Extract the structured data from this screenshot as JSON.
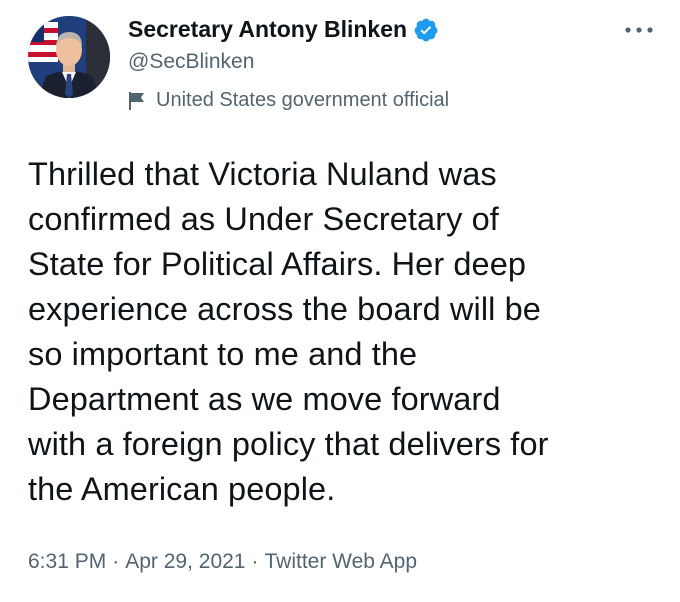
{
  "author": {
    "display_name": "Secretary Antony Blinken",
    "handle": "@SecBlinken",
    "label": "United States government official",
    "verified_color": "#1d9bf0"
  },
  "tweet": {
    "text": "Thrilled that Victoria Nuland was\nconfirmed as Under Secretary of\nState for Political Affairs. Her deep\nexperience across the board will be\nso important to me and the\nDepartment as we move forward\nwith a foreign policy that delivers for\nthe American people."
  },
  "meta": {
    "time": "6:31 PM",
    "separator": "·",
    "date": "Apr 29, 2021",
    "source": "Twitter Web App"
  },
  "icons": {
    "more": "more-horizontal-icon",
    "verified": "verified-badge-icon",
    "label": "flag-icon"
  },
  "colors": {
    "text_primary": "#0f1419",
    "text_secondary": "#536471",
    "accent": "#1d9bf0"
  }
}
